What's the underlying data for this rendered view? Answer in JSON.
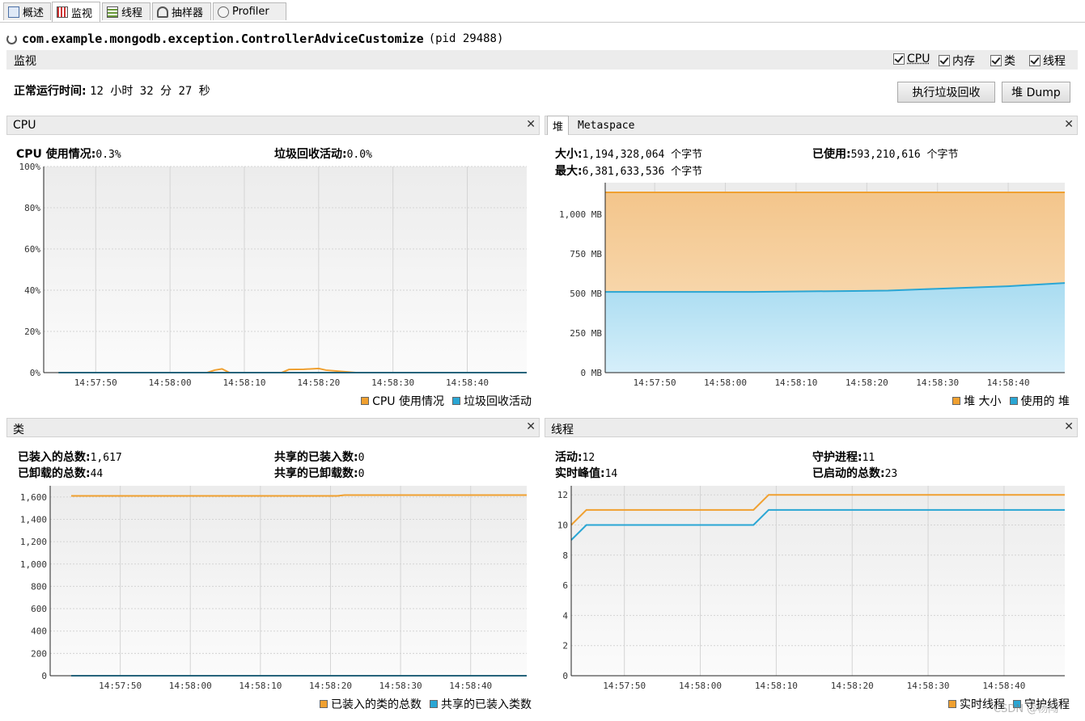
{
  "tabs": [
    {
      "label": "概述",
      "icon": "overview-icon"
    },
    {
      "label": "监视",
      "icon": "monitor-icon"
    },
    {
      "label": "线程",
      "icon": "threads-icon"
    },
    {
      "label": "抽样器",
      "icon": "sampler-icon"
    },
    {
      "label": "Profiler",
      "icon": "profiler-icon"
    }
  ],
  "app": {
    "name": "com.example.mongodb.exception.ControllerAdviceCustomize",
    "pid": "(pid 29488)"
  },
  "monitor": {
    "label": "监视",
    "checkboxes": [
      {
        "label": "CPU",
        "checked": true
      },
      {
        "label": "内存",
        "checked": true
      },
      {
        "label": "类",
        "checked": true
      },
      {
        "label": "线程",
        "checked": true
      }
    ],
    "uptime_label": "正常运行时间:",
    "uptime_value": "12 小时 32 分 27 秒",
    "gc_button": "执行垃圾回收",
    "dump_button": "堆 Dump"
  },
  "cpu_panel": {
    "title": "CPU",
    "usage_label": "CPU 使用情况:",
    "usage_value": "0.3%",
    "gc_label": "垃圾回收活动:",
    "gc_value": "0.0%",
    "legend": [
      "CPU 使用情况",
      "垃圾回收活动"
    ]
  },
  "heap_panel": {
    "tab_heap": "堆",
    "tab_meta": "Metaspace",
    "size_label": "大小:",
    "size_value": "1,194,328,064 个字节",
    "used_label": "已使用:",
    "used_value": "593,210,616 个字节",
    "max_label": "最大:",
    "max_value": "6,381,633,536 个字节",
    "legend": [
      "堆 大小",
      "使用的 堆"
    ]
  },
  "classes_panel": {
    "title": "类",
    "loaded_label": "已装入的总数:",
    "loaded_value": "1,617",
    "unloaded_label": "已卸载的总数:",
    "unloaded_value": "44",
    "shared_loaded_label": "共享的已装入数:",
    "shared_loaded_value": "0",
    "shared_unloaded_label": "共享的已卸载数:",
    "shared_unloaded_value": "0",
    "legend": [
      "已装入的类的总数",
      "共享的已装入类数"
    ]
  },
  "threads_panel": {
    "title": "线程",
    "live_label": "活动:",
    "live_value": "12",
    "daemon_label": "守护进程:",
    "daemon_value": "11",
    "peak_label": "实时峰值:",
    "peak_value": "14",
    "started_label": "已启动的总数:",
    "started_value": "23",
    "legend": [
      "实时线程",
      "守护线程"
    ]
  },
  "colors": {
    "orange": "#f0a030",
    "blue": "#2aa6d4"
  },
  "watermark": "CSDN @杨闯",
  "chart_data": [
    {
      "type": "line",
      "name": "cpu",
      "x": [
        "14:57:45",
        "14:57:50",
        "14:57:55",
        "14:58:00",
        "14:58:05",
        "14:58:06",
        "14:58:07",
        "14:58:08",
        "14:58:12",
        "14:58:15",
        "14:58:16",
        "14:58:18",
        "14:58:20",
        "14:58:21",
        "14:58:25",
        "14:58:48"
      ],
      "series": [
        {
          "name": "CPU 使用情况",
          "values": [
            0,
            0,
            0,
            0,
            0,
            1.2,
            1.8,
            0,
            0,
            0,
            1.5,
            1.6,
            2.0,
            1.2,
            0,
            0
          ]
        },
        {
          "name": "垃圾回收活动",
          "values": [
            0,
            0,
            0,
            0,
            0,
            0,
            0,
            0,
            0,
            0,
            0,
            0,
            0,
            0,
            0,
            0
          ]
        }
      ],
      "yticks": [
        "0%",
        "20%",
        "40%",
        "60%",
        "80%",
        "100%"
      ],
      "xticks": [
        "14:57:50",
        "14:58:00",
        "14:58:10",
        "14:58:20",
        "14:58:30",
        "14:58:40"
      ],
      "ylim": [
        0,
        100
      ],
      "grid": true,
      "legend": "bottom-right"
    },
    {
      "type": "area",
      "name": "heap",
      "x": [
        "14:57:43",
        "14:58:04",
        "14:58:18",
        "14:58:23",
        "14:58:30",
        "14:58:40",
        "14:58:48"
      ],
      "series": [
        {
          "name": "堆 大小",
          "values": [
            1139,
            1139,
            1139,
            1139,
            1139,
            1139,
            1139
          ]
        },
        {
          "name": "使用的 堆",
          "values": [
            510,
            510,
            516,
            518,
            530,
            546,
            566
          ]
        }
      ],
      "yticks": [
        "0 MB",
        "250 MB",
        "500 MB",
        "750 MB",
        "1,000 MB"
      ],
      "xticks": [
        "14:57:50",
        "14:58:00",
        "14:58:10",
        "14:58:20",
        "14:58:30",
        "14:58:40"
      ],
      "ylim": [
        0,
        1200
      ],
      "grid": true,
      "legend": "bottom-right"
    },
    {
      "type": "line",
      "name": "classes",
      "x": [
        "14:57:43",
        "14:58:21",
        "14:58:22",
        "14:58:48"
      ],
      "series": [
        {
          "name": "已装入的类的总数",
          "values": [
            1610,
            1610,
            1617,
            1617
          ]
        },
        {
          "name": "共享的已装入类数",
          "values": [
            0,
            0,
            0,
            0
          ]
        }
      ],
      "yticks": [
        "0",
        "200",
        "400",
        "600",
        "800",
        "1,000",
        "1,200",
        "1,400",
        "1,600"
      ],
      "xticks": [
        "14:57:50",
        "14:58:00",
        "14:58:10",
        "14:58:20",
        "14:58:30",
        "14:58:40"
      ],
      "ylim": [
        0,
        1700
      ],
      "grid": true,
      "legend": "bottom-right"
    },
    {
      "type": "line",
      "name": "threads",
      "x": [
        "14:57:43",
        "14:57:45",
        "14:58:07",
        "14:58:09",
        "14:58:48"
      ],
      "series": [
        {
          "name": "实时线程",
          "values": [
            10,
            11,
            11,
            12,
            12
          ]
        },
        {
          "name": "守护线程",
          "values": [
            9,
            10,
            10,
            11,
            11
          ]
        }
      ],
      "yticks": [
        "0",
        "2",
        "4",
        "6",
        "8",
        "10",
        "12"
      ],
      "xticks": [
        "14:57:50",
        "14:58:00",
        "14:58:10",
        "14:58:20",
        "14:58:30",
        "14:58:40"
      ],
      "ylim": [
        0,
        12.6
      ],
      "grid": true,
      "legend": "bottom-right"
    }
  ]
}
